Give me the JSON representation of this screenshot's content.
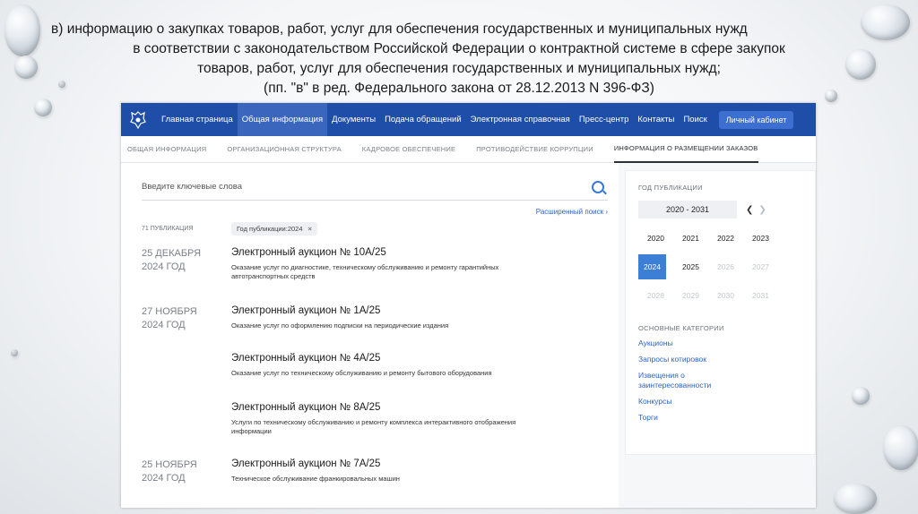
{
  "heading": {
    "line1": "в) информацию о закупках товаров, работ, услуг для обеспечения государственных и муниципальных нужд",
    "line2": "в соответствии с законодательством Российской Федерации о контрактной системе в сфере закупок",
    "line3": "товаров, работ, услуг для обеспечения государственных и муниципальных нужд;",
    "line4": "(пп. \"в\" в ред. Федерального закона от 28.12.2013 N 396-ФЗ)"
  },
  "topnav": {
    "items": [
      "Главная страница",
      "Общая информация",
      "Документы",
      "Подача обращений",
      "Электронная справочная",
      "Пресс-центр",
      "Контакты",
      "Поиск"
    ],
    "cabinet": "Личный кабинет"
  },
  "subnav": {
    "items": [
      "Общая информация",
      "Организационная структура",
      "Кадровое обеспечение",
      "Противодействие коррупции",
      "Информация о размещении заказов"
    ]
  },
  "search": {
    "placeholder": "Введите ключевые слова",
    "advanced": "Расширенный поиск ›"
  },
  "results": {
    "count": "71 публикация",
    "filter_chip": "Год публикации:2024",
    "entries": [
      {
        "date1": "25 ДЕКАБРЯ",
        "date2": "2024 ГОД",
        "title": "Электронный аукцион № 10А/25",
        "desc": "Оказание услуг по диагностике, техническому обслуживанию и ремонту гарантийных автотранспортных средств"
      },
      {
        "date1": "27 НОЯБРЯ",
        "date2": "2024 ГОД",
        "title": "Электронный аукцион № 1А/25",
        "desc": "Оказание услуг по оформлению подписки на периодические издания"
      },
      {
        "date1": "",
        "date2": "",
        "title": "Электронный аукцион № 4А/25",
        "desc": "Оказание услуг по техническому обслуживанию и ремонту бытового оборудования"
      },
      {
        "date1": "",
        "date2": "",
        "title": "Электронный аукцион № 8А/25",
        "desc": "Услуги по техническому обслуживанию и ремонту комплекса интерактивного отображения информации"
      },
      {
        "date1": "25 НОЯБРЯ",
        "date2": "2024 ГОД",
        "title": "Электронный аукцион № 7А/25",
        "desc": "Техническое обслуживание франкировальных машин"
      }
    ]
  },
  "aside": {
    "year_heading": "Год публикации",
    "range": "2020 - 2031",
    "years": [
      "2020",
      "2021",
      "2022",
      "2023",
      "2024",
      "2025",
      "2026",
      "2027",
      "2028",
      "2029",
      "2030",
      "2031"
    ],
    "selected_year": "2024",
    "categories_heading": "Основные категории",
    "categories": [
      "Аукционы",
      "Запросы котировок",
      "Извещения о заинтересованности",
      "Конкурсы",
      "Торги"
    ]
  }
}
